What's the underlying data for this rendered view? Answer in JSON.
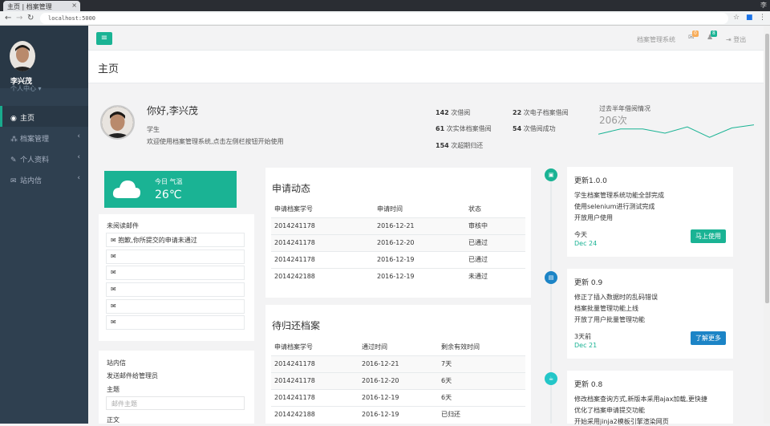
{
  "browser": {
    "tab_title": "主页 | 档案管理",
    "window_label": "李",
    "url": "localhost:5000"
  },
  "sidebar": {
    "user_name": "李兴茂",
    "user_menu": "个人中心 ▾",
    "items": [
      {
        "label": "主页",
        "icon": "globe-icon"
      },
      {
        "label": "档案管理",
        "icon": "sitemap-icon"
      },
      {
        "label": "个人资料",
        "icon": "edit-icon"
      },
      {
        "label": "站内信",
        "icon": "envelope-icon"
      }
    ]
  },
  "header": {
    "system_name": "档案管理系统",
    "mail_badge": "0",
    "bell_badge": "8",
    "logout": "登出"
  },
  "page": {
    "title": "主页"
  },
  "profile": {
    "greeting": "你好,李兴茂",
    "role": "学生",
    "welcome": "欢迎使用档案管理系统,点击左侧栏按钮开始使用",
    "stats": [
      {
        "num": "142",
        "label": " 次借阅"
      },
      {
        "num": "22",
        "label": " 次电子档案借阅"
      },
      {
        "num": "61",
        "label": " 次实体档案借阅"
      },
      {
        "num": "54",
        "label": " 次借阅成功"
      },
      {
        "num": "154",
        "label": " 次超期归还"
      }
    ],
    "half_year_title": "过去半年借阅情况",
    "half_year_value": "206次",
    "half_year_series": [
      9,
      14,
      14,
      10,
      16,
      6,
      15,
      18
    ]
  },
  "weather": {
    "label": "今日 气温",
    "temp": "26℃",
    "icon": "cloud-icon"
  },
  "mail": {
    "title": "未阅读邮件",
    "rows": [
      "抱歉,你所提交的申请未通过",
      "",
      "",
      "",
      "",
      ""
    ]
  },
  "message": {
    "title": "站内信",
    "desc": "发送邮件给管理员",
    "subject_label": "主题",
    "subject_placeholder": "邮件主题",
    "body_label": "正文"
  },
  "apply_dynamics": {
    "title": "申请动态",
    "headers": [
      "申请档案学号",
      "申请时间",
      "状态"
    ],
    "rows": [
      [
        "2014241178",
        "2016-12-21",
        "审核中"
      ],
      [
        "2014241178",
        "2016-12-20",
        "已通过"
      ],
      [
        "2014241178",
        "2016-12-19",
        "已通过"
      ],
      [
        "2014242188",
        "2016-12-19",
        "未通过"
      ]
    ]
  },
  "pending_return": {
    "title": "待归还档案",
    "headers": [
      "申请档案学号",
      "通过时间",
      "剩余有效时间"
    ],
    "rows": [
      [
        "2014241178",
        "2016-12-21",
        "7天"
      ],
      [
        "2014241178",
        "2016-12-20",
        "6天"
      ],
      [
        "2014241178",
        "2016-12-19",
        "6天"
      ],
      [
        "2014242188",
        "2016-12-19",
        "已归还"
      ]
    ]
  },
  "timeline": [
    {
      "title": "更新1.0.0",
      "lines": [
        "学生档案管理系统功能全部完成",
        "使用selenium进行测试完成",
        "开放用户使用"
      ],
      "when": "今天",
      "date": "Dec 24",
      "button": "马上使用",
      "icon": "briefcase-icon",
      "color": "#1ab394"
    },
    {
      "title": "更新 0.9",
      "lines": [
        "修正了插入数据时的乱码错误",
        "档案批量管理功能上线",
        "开放了用户批量管理功能"
      ],
      "when": "3天前",
      "date": "Dec 21",
      "button": "了解更多",
      "icon": "file-icon",
      "color": "#1c84c6"
    },
    {
      "title": "更新 0.8",
      "lines": [
        "修改档案查询方式,新版本采用ajax加载,更快捷",
        "优化了档案申请提交功能",
        "开始采用jinja2模板引擎渲染网页"
      ],
      "icon": "coffee-icon",
      "color": "#23c6c8"
    }
  ]
}
